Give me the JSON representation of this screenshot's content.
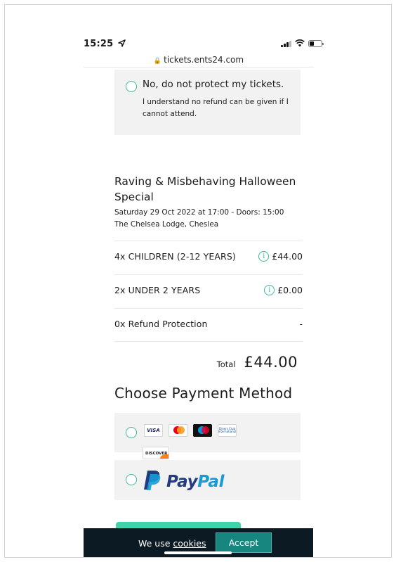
{
  "status_bar": {
    "time": "15:25",
    "location_icon": "location-arrow-icon",
    "icons": [
      "signal-icon",
      "wifi-icon",
      "battery-icon"
    ]
  },
  "browser": {
    "url": "tickets.ents24.com"
  },
  "refund_protection": {
    "option_label": "No, do not protect my tickets.",
    "option_description": "I understand no refund can be given if I cannot attend."
  },
  "event": {
    "title": "Raving & Misbehaving Halloween Special",
    "date_line": "Saturday 29 Oct 2022 at 17:00 - Doors: 15:00",
    "venue_line": "The Chelsea Lodge, Cheslea"
  },
  "tickets": [
    {
      "name": "4x CHILDREN (2-12 YEARS)",
      "price": "£44.00",
      "has_info": true
    },
    {
      "name": "2x UNDER 2 YEARS",
      "price": "£0.00",
      "has_info": true
    },
    {
      "name": "0x Refund Protection",
      "price": "-",
      "has_info": false
    }
  ],
  "order_total": {
    "label": "Total",
    "value": "£44.00"
  },
  "payment": {
    "heading": "Choose Payment Method",
    "card_logos": {
      "visa": "VISA",
      "diners": "Diners Club International",
      "discover": "DISCOVER"
    },
    "paypal": {
      "pay": "Pay",
      "pal": "Pal"
    }
  },
  "cookie_banner": {
    "prefix": "We use",
    "link": "cookies",
    "accept_label": "Accept"
  },
  "colors": {
    "accent_green": "#3db89a",
    "button_green": "#3ed3a8",
    "cookie_bg": "#0c1a24",
    "accept_bg": "#17867f",
    "paypal_dark": "#253b80",
    "paypal_light": "#179bd7"
  }
}
